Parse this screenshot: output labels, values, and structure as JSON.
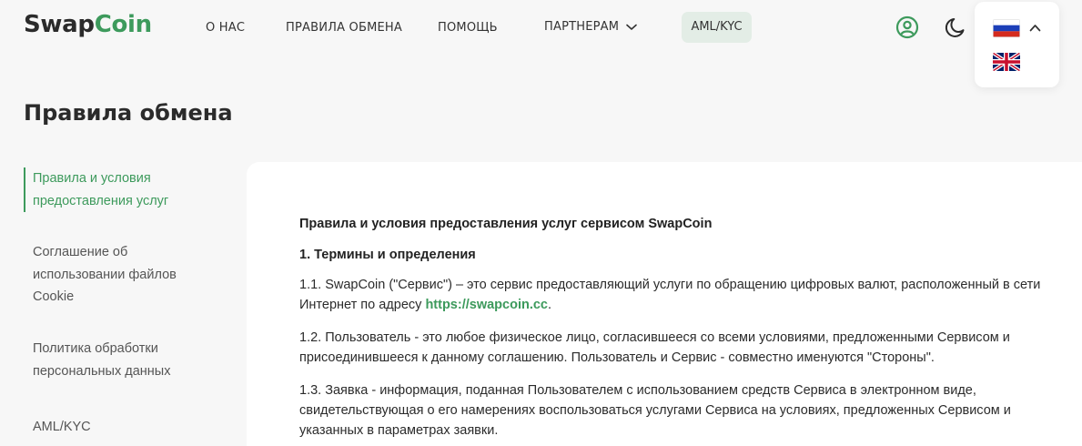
{
  "header": {
    "logo": {
      "part1": "Swap",
      "part2": "Coin"
    },
    "nav": {
      "about": "О НАС",
      "rules": "ПРАВИЛА ОБМЕНА",
      "help": "ПОМОЩЬ",
      "partners": "ПАРТНЕРАМ",
      "aml": "AML/KYC"
    },
    "icons": [
      "user-circle-icon",
      "moon-icon",
      "chevron-up-icon"
    ],
    "languages": [
      "ru-flag",
      "gb-flag"
    ]
  },
  "page": {
    "title": "Правила обмена"
  },
  "sidebar": {
    "items": [
      {
        "label": "Правила и условия предоставления услуг",
        "active": true
      },
      {
        "label": "Соглашение об использовании файлов Cookie",
        "active": false
      },
      {
        "label": "Политика обработки персональных данных",
        "active": false
      },
      {
        "label": "AML/KYC",
        "active": false
      }
    ]
  },
  "content": {
    "title": "Правила и условия предоставления услуг сервисом SwapCoin",
    "section1_title": "1. Термины и определения",
    "p1_before_link": "1.1. SwapCoin (\"Сервис\") – это сервис предоставляющий услуги по обращению цифровых валют, расположенный в сети Интернет по адресу ",
    "p1_link": "https://swapcoin.cc",
    "p1_after_link": ".",
    "p2": "1.2. Пользователь - это любое физическое лицо, согласившееся со всеми условиями, предложенными Сервисом и присоединившееся к данному соглашению. Пользователь и Сервис - совместно именуются \"Стороны\".",
    "p3": "1.3. Заявка - информация, поданная Пользователем с использованием средств Сервиса в электронном виде, свидетельствующая о его намерениях воспользоваться услугами Сервиса на условиях, предложенных Сервисом и указанных в параметрах заявки."
  },
  "colors": {
    "accent": "#3d9a5c",
    "background": "#f7f7f7",
    "aml_bg": "#e3ede6"
  }
}
